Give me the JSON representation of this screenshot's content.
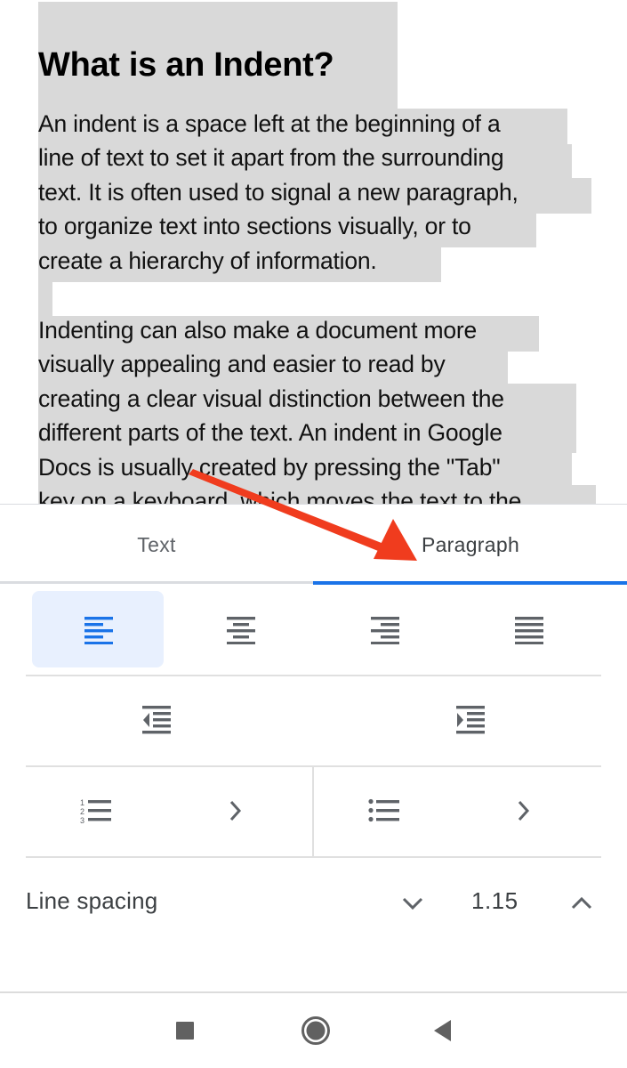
{
  "document": {
    "heading": "What is an Indent?",
    "paragraph1_lines": [
      "An indent is a space left at the beginning of a",
      "line of text to set it apart from the surrounding",
      "text. It is often used to signal a new paragraph,",
      "to organize text into sections visually, or to",
      "create a hierarchy of information."
    ],
    "paragraph2_lines": [
      "Indenting can also make a document more",
      "visually appealing and easier to read by",
      "creating a clear visual distinction between the",
      "different parts of the text. An indent in Google",
      "Docs is usually created by pressing the \"Tab\"",
      "key on a keyboard, which moves the text to the"
    ],
    "selection_color": "#d9d9d9"
  },
  "format_panel": {
    "tabs": [
      {
        "label": "Text",
        "selected": false
      },
      {
        "label": "Paragraph",
        "selected": true
      }
    ],
    "accent_color": "#1a73e8",
    "alignment": {
      "options": [
        "align-left",
        "align-center",
        "align-right",
        "align-justify"
      ],
      "selected": "align-left"
    },
    "indent": {
      "decrease": "decrease-indent",
      "increase": "increase-indent"
    },
    "lists": {
      "numbered": "numbered-list",
      "bulleted": "bulleted-list"
    },
    "line_spacing": {
      "label": "Line spacing",
      "value": "1.15"
    }
  },
  "annotation": {
    "type": "arrow",
    "color": "#f03c1e",
    "points_to": "Paragraph"
  },
  "navbar": {
    "buttons": [
      "recents",
      "home",
      "back"
    ]
  }
}
